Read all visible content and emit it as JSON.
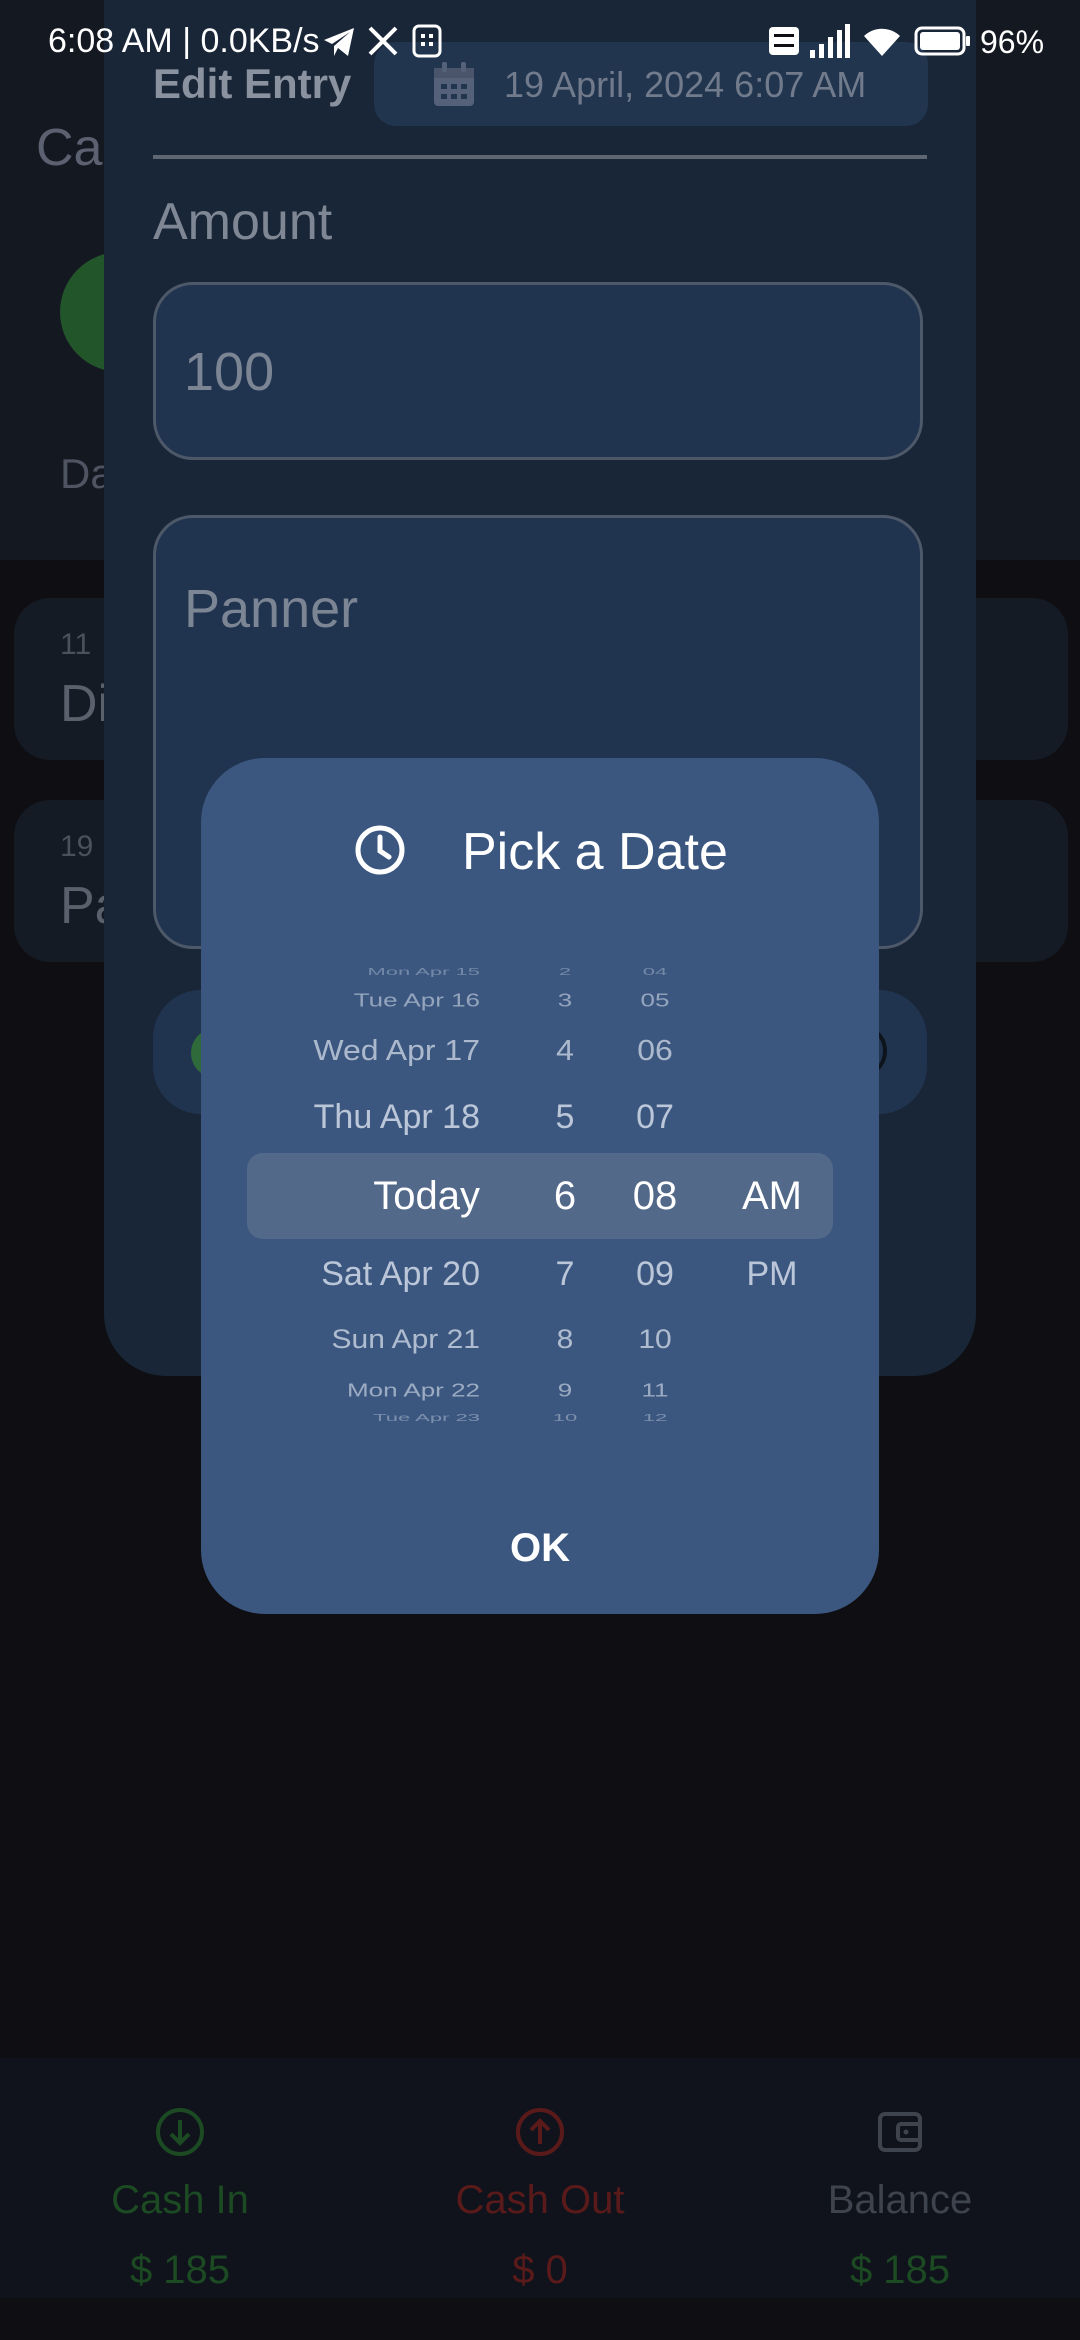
{
  "status_bar": {
    "time": "6:08 AM | 0.0KB/s",
    "battery": "96%",
    "icons": [
      "telegram-icon",
      "x-icon",
      "app-icon",
      "volte-icon",
      "signal-icon",
      "wifi-icon",
      "battery-icon"
    ]
  },
  "background": {
    "title": "Ca",
    "label": "Da",
    "entries": [
      {
        "date": "11",
        "name": "Di"
      },
      {
        "date": "19",
        "name": "Pa"
      }
    ],
    "bottom_nav": [
      {
        "label": "Cash In",
        "amount": "$ 185",
        "color": "#1c4a22",
        "icon": "arrow-down-circle-icon"
      },
      {
        "label": "Cash Out",
        "amount": "$ 0",
        "color": "#5a1a1a",
        "icon": "arrow-up-circle-icon"
      },
      {
        "label": "Balance",
        "amount": "$ 185",
        "color": "#1c4a22",
        "icon": "wallet-icon"
      }
    ]
  },
  "edit_entry": {
    "title": "Edit Entry",
    "date_value": "19 April, 2024 6:07 AM",
    "amount_label": "Amount",
    "amount_value": "100",
    "note_value": "Panner"
  },
  "dialog": {
    "title": "Pick a Date",
    "ok_label": "OK",
    "date_wheel": [
      "Mon Apr 15",
      "Tue Apr 16",
      "Wed Apr 17",
      "Thu Apr 18",
      "Today",
      "Sat Apr 20",
      "Sun Apr 21",
      "Mon Apr 22",
      "Tue Apr 23"
    ],
    "hour_wheel": [
      "2",
      "3",
      "4",
      "5",
      "6",
      "7",
      "8",
      "9",
      "10"
    ],
    "minute_wheel": [
      "04",
      "05",
      "06",
      "07",
      "08",
      "09",
      "10",
      "11",
      "12"
    ],
    "ampm_wheel": [
      "AM",
      "PM"
    ],
    "selected": {
      "date": "Today",
      "hour": "6",
      "minute": "08",
      "ampm": "AM"
    }
  },
  "colors": {
    "dialog_bg": "#3b5780",
    "selection_band": "#53698a",
    "sheet_bg": "#192637"
  }
}
